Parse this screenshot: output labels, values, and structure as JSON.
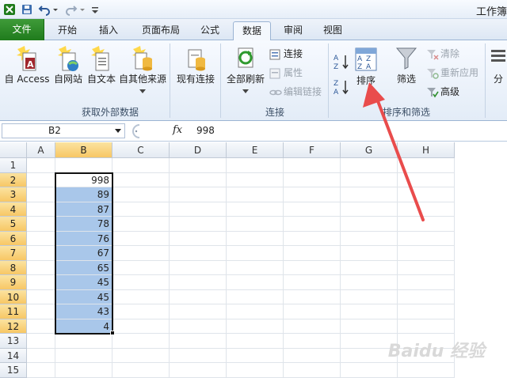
{
  "window": {
    "title": "工作簿"
  },
  "tabs": {
    "file": "文件",
    "home": "开始",
    "insert": "插入",
    "layout": "页面布局",
    "formulas": "公式",
    "data": "数据",
    "review": "审阅",
    "view": "视图"
  },
  "ribbon": {
    "external": {
      "access": "自 Access",
      "web": "自网站",
      "text": "自文本",
      "other": "自其他来源",
      "existing": "现有连接",
      "label": "获取外部数据"
    },
    "connections": {
      "refresh_all": "全部刷新",
      "connections": "连接",
      "properties": "属性",
      "edit_links": "编辑链接",
      "label": "连接"
    },
    "sort_filter": {
      "sort": "排序",
      "filter": "筛选",
      "clear": "清除",
      "reapply": "重新应用",
      "advanced": "高级",
      "label": "排序和筛选"
    },
    "split": "分"
  },
  "formula_bar": {
    "name_box": "B2",
    "fx": "fx",
    "value": "998"
  },
  "columns": [
    "A",
    "B",
    "C",
    "D",
    "E",
    "F",
    "G",
    "H"
  ],
  "rows": [
    "1",
    "2",
    "3",
    "4",
    "5",
    "6",
    "7",
    "8",
    "9",
    "10",
    "11",
    "12",
    "13",
    "14",
    "15"
  ],
  "cells_b": [
    "998",
    "89",
    "87",
    "78",
    "76",
    "67",
    "65",
    "45",
    "45",
    "43",
    "4"
  ],
  "watermark": "Baidu 经验",
  "colors": {
    "selection": "#a9c7ea",
    "accent": "#1f7b1c",
    "arrow": "#e94c4c"
  }
}
